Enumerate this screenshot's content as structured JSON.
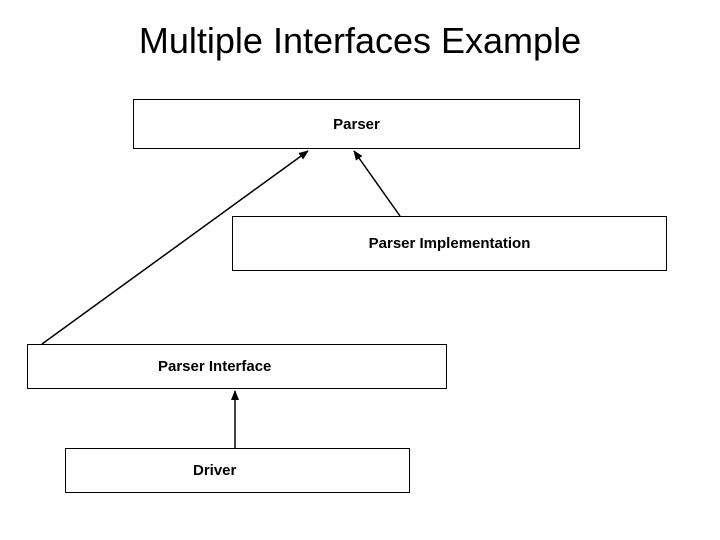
{
  "title": "Multiple Interfaces Example",
  "boxes": {
    "parser": "Parser",
    "implementation": "Parser Implementation",
    "interface": "Parser Interface",
    "driver": "Driver"
  }
}
